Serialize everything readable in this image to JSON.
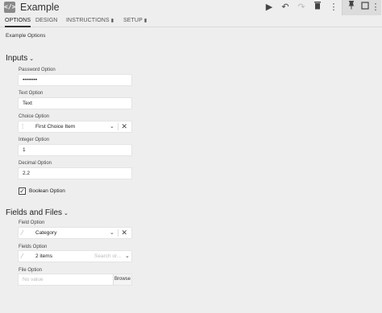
{
  "header": {
    "title": "Example",
    "tool_icon": "</>",
    "buttons": {
      "run_icon": "play-icon",
      "undo_icon": "undo-icon",
      "redo_icon": "redo-icon",
      "delete_icon": "trash-icon",
      "more_icon": "more-vertical-icon",
      "pin_icon": "pin-icon"
    }
  },
  "tabs": [
    {
      "label": "OPTIONS",
      "active": true
    },
    {
      "label": "DESIGN",
      "active": false
    },
    {
      "label": "INSTRUCTIONS",
      "badge": "▮",
      "active": false
    },
    {
      "label": "SETUP",
      "badge": "▮",
      "active": false
    }
  ],
  "section_description": "Example Options",
  "inputs_group": {
    "title": "Inputs",
    "password": {
      "label": "Password Option",
      "value": "••••••••"
    },
    "text": {
      "label": "Text Option",
      "value": "Text"
    },
    "choice": {
      "label": "Choice Option",
      "value": "First Choice Item"
    },
    "integer": {
      "label": "Integer Option",
      "value": "1"
    },
    "decimal": {
      "label": "Decimal Option",
      "value": "2.2"
    },
    "boolean": {
      "label": "Boolean Option",
      "checked": true
    }
  },
  "fields_group": {
    "title": "Fields and Files",
    "field": {
      "label": "Field Option",
      "value": "Category"
    },
    "fields": {
      "label": "Fields Option",
      "value": "2 items",
      "search_placeholder": "Search or..."
    },
    "file": {
      "label": "File Option",
      "placeholder": "No value",
      "browse_label": "Browse"
    }
  },
  "colors": {
    "background": "#eeeeee",
    "field_bg": "#ffffff",
    "accent": "#333333"
  }
}
